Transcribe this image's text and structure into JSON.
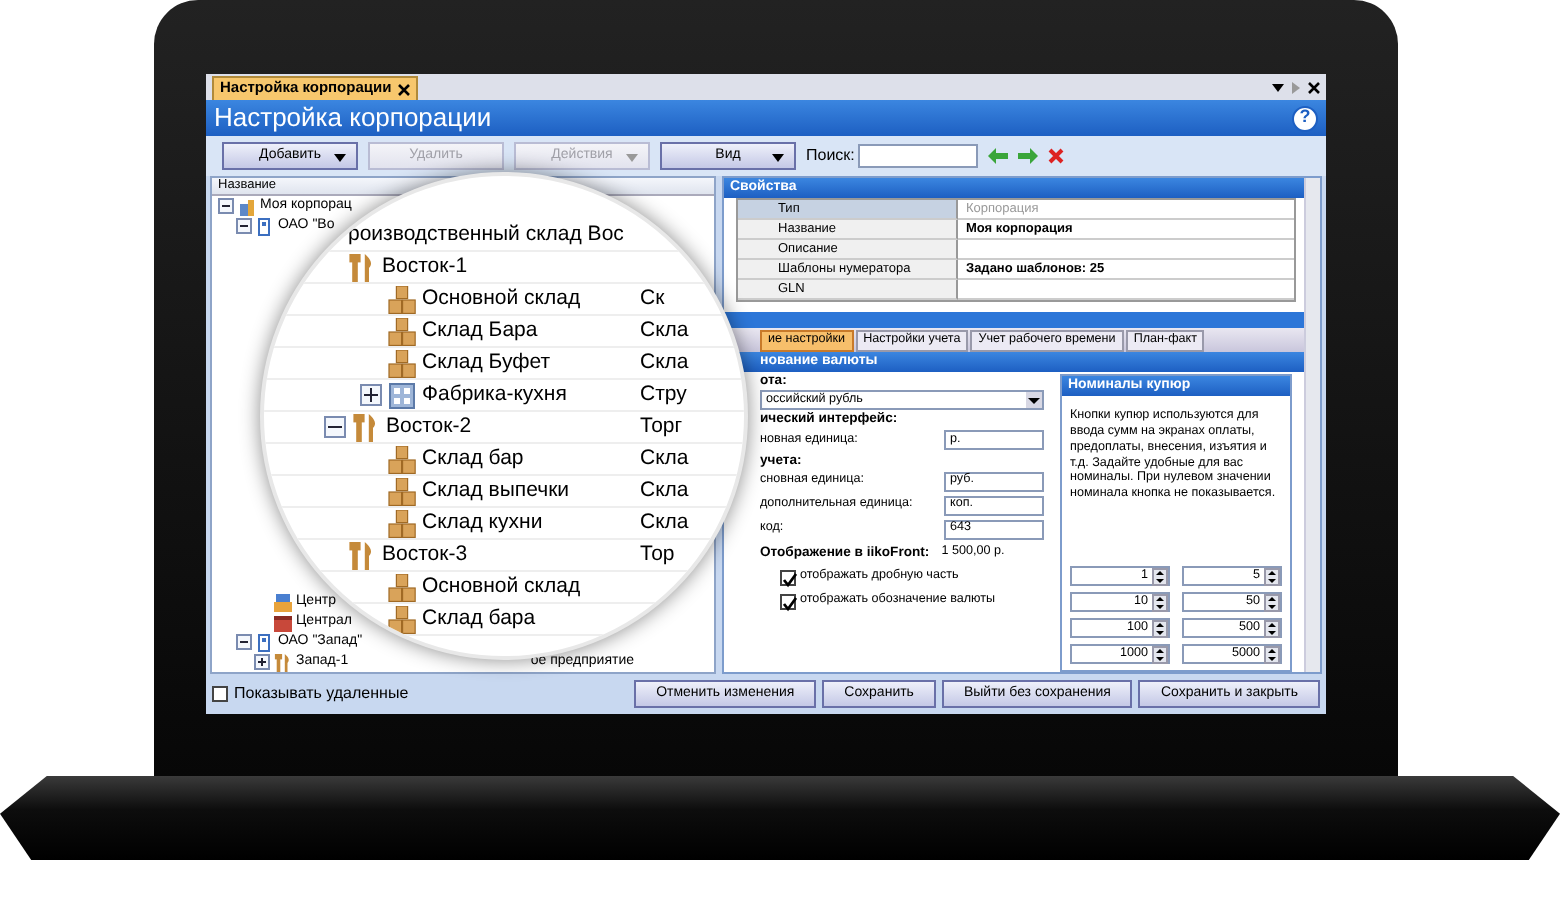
{
  "window_tab": {
    "label": "Настройка корпорации",
    "selected": true
  },
  "title": "Настройка корпорации",
  "help": "?",
  "toolbar": {
    "buttons": [
      {
        "label": "Добавить",
        "dropdown": true,
        "disabled": false
      },
      {
        "label": "Удалить",
        "dropdown": false,
        "disabled": true
      },
      {
        "label": "Действия",
        "dropdown": true,
        "disabled": true
      },
      {
        "label": "Вид",
        "dropdown": true,
        "disabled": false
      }
    ],
    "search_label": "Поиск:"
  },
  "tree": {
    "column": "Название",
    "rows": [
      {
        "label": "Моя корпорац",
        "kind": "corp",
        "expanded": true,
        "children": [
          {
            "label": "ОАО \"Во",
            "kind": "company",
            "expanded": true,
            "children": [
              {
                "label": "Центр",
                "kind": "store"
              },
              {
                "label": "Централ",
                "kind": "shop"
              }
            ]
          },
          {
            "label": "ОАО \"Запад\"",
            "kind": "company",
            "expanded": true,
            "children": [
              {
                "label": "Запад-1",
                "kind": "point",
                "expanded": false,
                "type": "ое предприятие"
              }
            ]
          }
        ]
      }
    ]
  },
  "magnifier": {
    "rows": [
      {
        "label": "роизводственный склад Вос",
        "kind": "none"
      },
      {
        "label": "Восток-1",
        "kind": "point",
        "children": [
          {
            "label": "Основной склад",
            "kind": "warehouse",
            "type": "Ск"
          },
          {
            "label": "Склад Бара",
            "kind": "warehouse",
            "type": "Скла"
          },
          {
            "label": "Склад Буфет",
            "kind": "warehouse",
            "type": "Скла"
          },
          {
            "label": "Фабрика-кухня",
            "kind": "factory",
            "expanded": false,
            "type": "Стру"
          }
        ]
      },
      {
        "label": "Восток-2",
        "kind": "point",
        "expanded": true,
        "type": "Торг",
        "children": [
          {
            "label": "Склад бар",
            "kind": "warehouse",
            "type": "Скла"
          },
          {
            "label": "Склад выпечки",
            "kind": "warehouse",
            "type": "Скла"
          },
          {
            "label": "Склад кухни",
            "kind": "warehouse",
            "type": "Скла"
          }
        ]
      },
      {
        "label": "Восток-3",
        "kind": "point",
        "type": "Тор",
        "children": [
          {
            "label": "Основной склад",
            "kind": "warehouse"
          },
          {
            "label": "Склад бара",
            "kind": "warehouse"
          }
        ]
      }
    ]
  },
  "properties": {
    "title": "Свойства",
    "rows": [
      {
        "name": "Тип",
        "value": "Корпорация",
        "selected": true,
        "muted": true,
        "emphasis": false
      },
      {
        "name": "Название",
        "value": "Моя корпорация",
        "selected": false,
        "muted": false,
        "emphasis": true
      },
      {
        "name": "Описание",
        "selected": false
      },
      {
        "name": "Шаблоны нумератора",
        "value": "Задано шаблонов: 25",
        "selected": false,
        "muted": false,
        "emphasis": true
      },
      {
        "name": "GLN",
        "selected": false
      }
    ]
  },
  "tabs": [
    {
      "label": "ие настройки",
      "selected": true
    },
    {
      "label": "Настройки учета",
      "selected": false
    },
    {
      "label": "Учет рабочего времени",
      "selected": false
    },
    {
      "label": "План-факт",
      "selected": false
    }
  ],
  "currency": {
    "header": "нование валюты",
    "currency_label": "ота:",
    "currency_value": "оссийский рубль",
    "ui_label": "ический интерфейс:",
    "ui_fields": [
      {
        "label": "новная единица:",
        "value": "р."
      }
    ],
    "accounting_label": "учета:",
    "accounting_fields": [
      {
        "label": "сновная единица:",
        "value": "руб."
      },
      {
        "label": "дополнительная единица:",
        "value": "коп."
      },
      {
        "label": "код:",
        "value": "643"
      }
    ],
    "display_label": "Отображение в iikoFront:",
    "display_value": "1 500,00 р.",
    "checks": [
      {
        "label": "отображать дробную часть",
        "checked": true
      },
      {
        "label": "отображать обозначение валюты",
        "checked": true
      }
    ]
  },
  "denominations": {
    "title": "Номиналы купюр",
    "text": "Кнопки купюр используются для ввода сумм на экранах оплаты, предоплаты, внесения, изъятия и т.д. Задайте удобные для вас номиналы. При нулевом значении номинала кнопка не показывается.",
    "values": [
      [
        "1",
        "5"
      ],
      [
        "10",
        "50"
      ],
      [
        "100",
        "500"
      ],
      [
        "1000",
        "5000"
      ]
    ]
  },
  "show_deleted": {
    "label": "Показывать удаленные",
    "checked": false
  },
  "buttons": [
    "Отменить изменения",
    "Сохранить",
    "Выйти без сохранения",
    "Сохранить и закрыть"
  ]
}
